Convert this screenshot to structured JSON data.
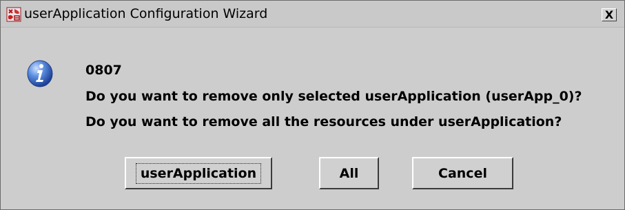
{
  "window": {
    "title": "userApplication Configuration Wizard",
    "close_label": "X"
  },
  "message": {
    "code": "0807",
    "line1": "Do you want to remove only selected userApplication (userApp_0)?",
    "line2": "Do you want to remove all the resources under userApplication?",
    "icon": "info-icon"
  },
  "buttons": {
    "userapp_label": "userApplication",
    "all_label": "All",
    "cancel_label": "Cancel"
  },
  "colors": {
    "dialog_bg": "#cdcdcd",
    "info_icon_blue": "#2a66c4"
  }
}
